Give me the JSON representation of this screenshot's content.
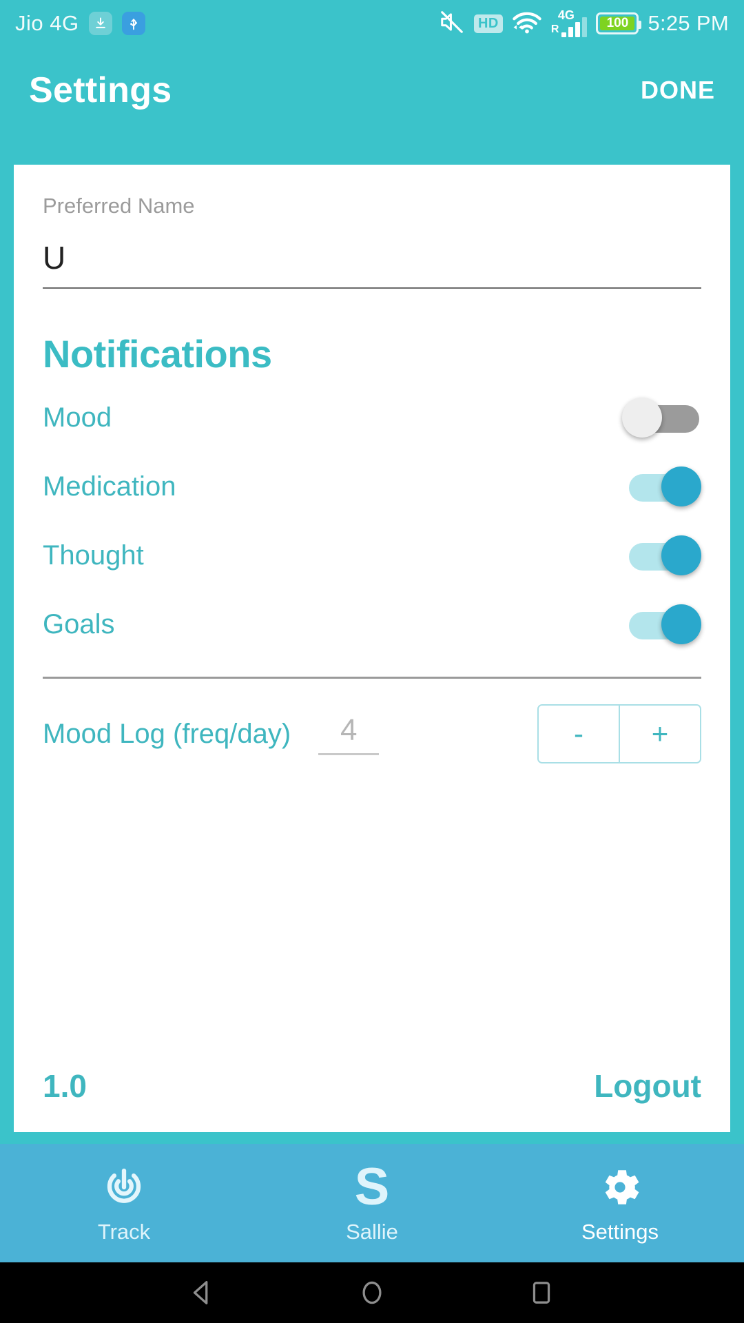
{
  "theme": {
    "primary": "#3bc3ca",
    "accent": "#3fb6bf",
    "tabbar": "#4bb2d6",
    "switch_on_knob": "#2aa8cc",
    "switch_on_track": "#b3e5ec",
    "switch_off_track": "#9b9b9b",
    "card_bg": "#ffffff"
  },
  "statusbar": {
    "carrier": "Jio 4G",
    "download_icon": "download-icon",
    "usb_icon": "usb-icon",
    "mute_icon": "mute-icon",
    "hd_label": "HD",
    "wifi_icon": "wifi-icon",
    "network_type": "4G",
    "roaming_label": "R",
    "signal_icon": "signal-bars-icon",
    "battery_level": "100",
    "time": "5:25 PM"
  },
  "header": {
    "title": "Settings",
    "done_label": "DONE"
  },
  "preferred_name": {
    "label": "Preferred Name",
    "value": "U",
    "placeholder": "Preferred Name"
  },
  "notifications": {
    "section_title": "Notifications",
    "items": [
      {
        "label": "Mood",
        "state": "off"
      },
      {
        "label": "Medication",
        "state": "on"
      },
      {
        "label": "Thought",
        "state": "on"
      },
      {
        "label": "Goals",
        "state": "on"
      }
    ]
  },
  "mood_log": {
    "label": "Mood Log (freq/day)",
    "value": "4",
    "placeholder": "4",
    "minus_label": "-",
    "plus_label": "+"
  },
  "footer": {
    "version": "1.0",
    "logout_label": "Logout"
  },
  "tabbar": {
    "tabs": [
      {
        "label": "Track",
        "icon": "track-target-icon",
        "active": false
      },
      {
        "label": "Sallie",
        "icon": "sallie-s-icon",
        "active": false
      },
      {
        "label": "Settings",
        "icon": "gear-icon",
        "active": true
      }
    ]
  },
  "navbar": {
    "back": "back-triangle-icon",
    "home": "home-circle-icon",
    "recents": "recents-square-icon"
  }
}
